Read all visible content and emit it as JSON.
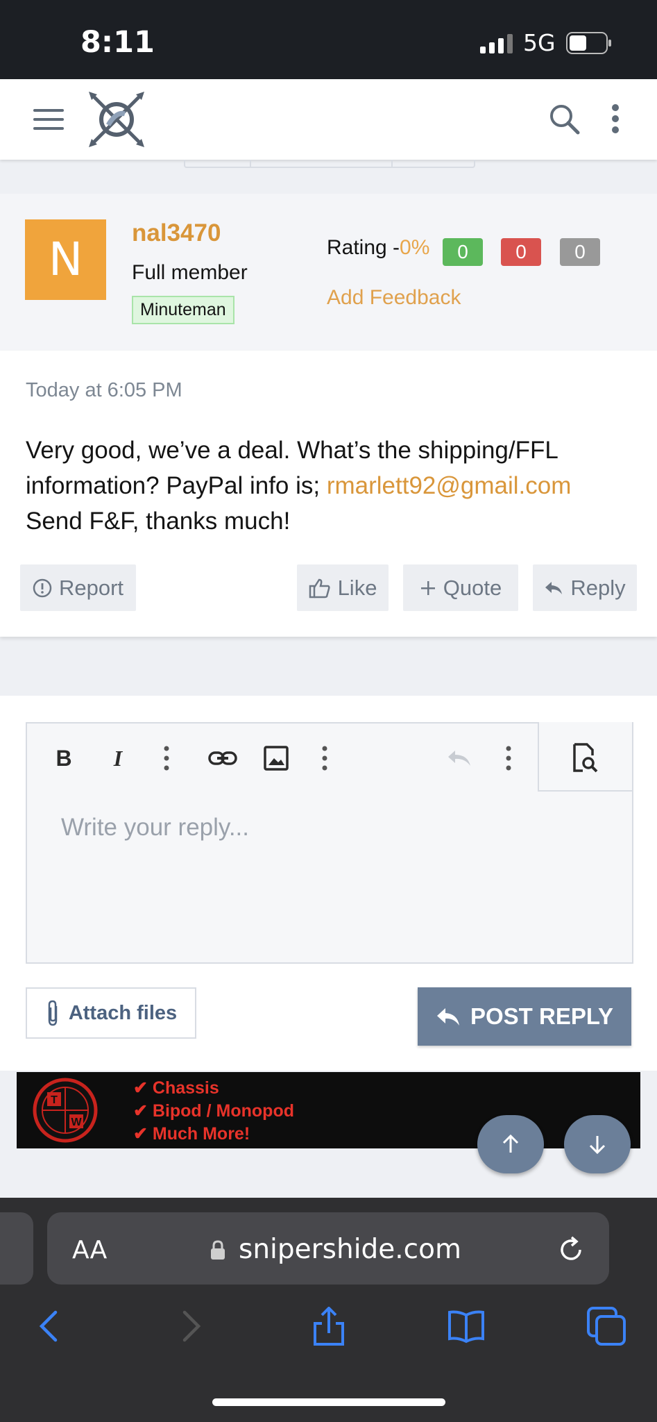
{
  "status_bar": {
    "time": "8:11",
    "network": "5G"
  },
  "header": {
    "logo_alt": "sniper's hide logo"
  },
  "user": {
    "avatar_letter": "N",
    "username": "nal3470",
    "title": "Full member",
    "badge": "Minuteman",
    "rating_label": "Rating -",
    "rating_pct": "0%",
    "positive": "0",
    "negative": "0",
    "neutral": "0",
    "add_feedback": "Add Feedback"
  },
  "post": {
    "date": "Today at 6:05 PM",
    "text_before_email": "Very good, we’ve a deal. What’s the shipping/FFL information? PayPal info is; ",
    "email": "rmarlett92@gmail.com",
    "text_after_email": "Send F&F, thanks much!",
    "actions": {
      "report": "Report",
      "like": "Like",
      "quote": "Quote",
      "reply": "Reply"
    }
  },
  "editor": {
    "placeholder": "Write your reply...",
    "attach_label": "Attach files",
    "post_reply_label": "POST REPLY"
  },
  "ad": {
    "logo_letters": [
      "T",
      "W"
    ],
    "lines": [
      "✔ Chassis",
      "✔ Bipod / Monopod",
      "✔ Much More!"
    ]
  },
  "browser": {
    "text_size_label": "AA",
    "url": "snipershide.com"
  },
  "colors": {
    "accent": "#d9963a",
    "button_primary": "#6b7f99",
    "positive": "#5cb85c",
    "negative": "#d9534f",
    "neutral": "#999999",
    "avatar_bg": "#f0a43c"
  }
}
